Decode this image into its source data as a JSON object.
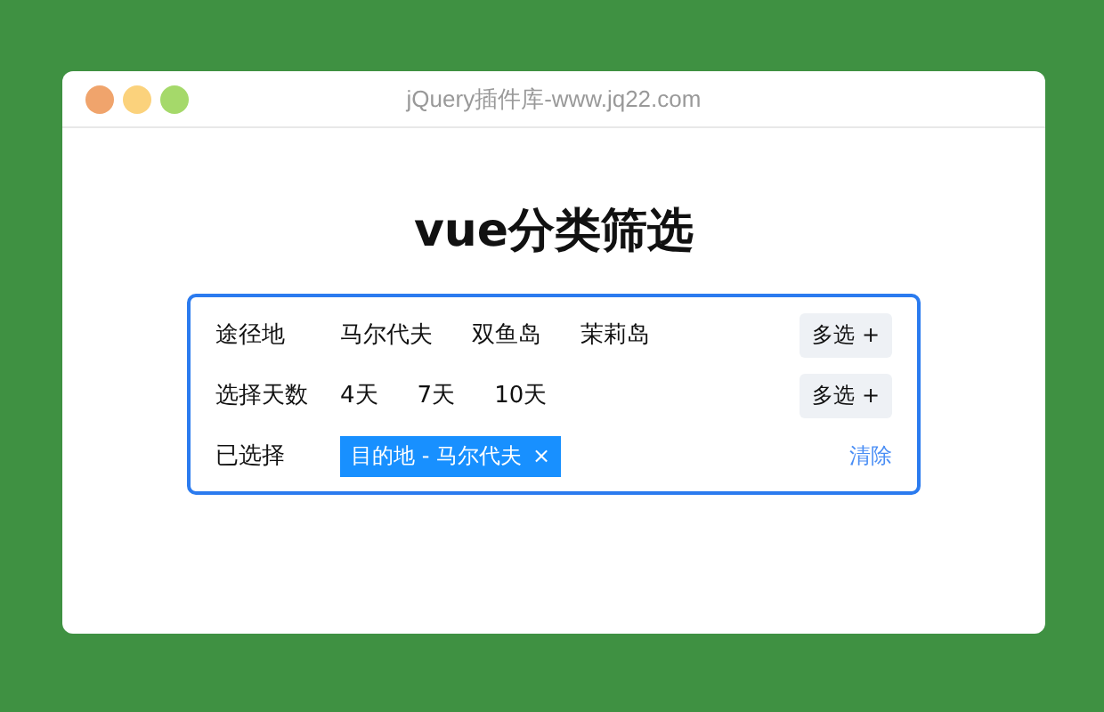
{
  "window": {
    "title": "jQuery插件库-www.jq22.com"
  },
  "heading": "vue分类筛选",
  "filters": [
    {
      "label": "途径地",
      "options": [
        "马尔代夫",
        "双鱼岛",
        "茉莉岛"
      ],
      "button": "多选 +"
    },
    {
      "label": "选择天数",
      "options": [
        "4天",
        "7天",
        "10天"
      ],
      "button": "多选 +"
    }
  ],
  "selected": {
    "label": "已选择",
    "tags": [
      {
        "text": "目的地 - 马尔代夫",
        "close": "×"
      }
    ],
    "clear": "清除"
  }
}
